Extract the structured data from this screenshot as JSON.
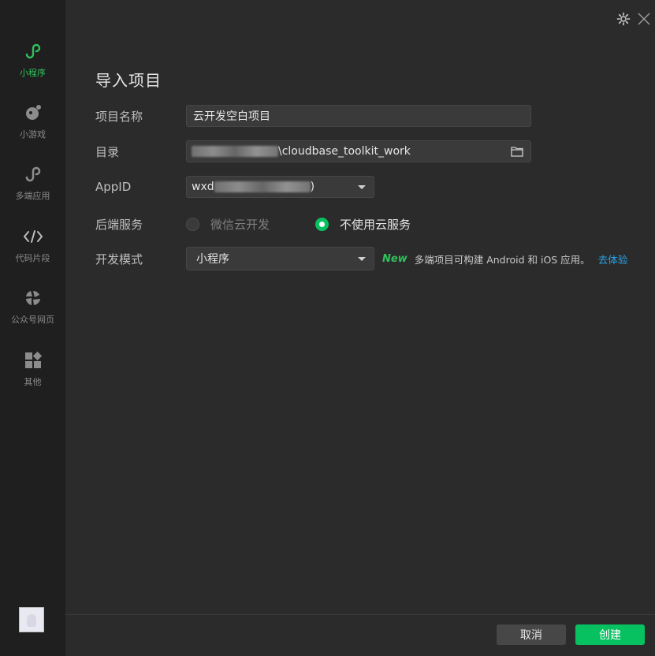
{
  "sidebar": {
    "items": [
      {
        "label": "小程序",
        "icon": "mini-program-icon"
      },
      {
        "label": "小游戏",
        "icon": "mini-game-icon"
      },
      {
        "label": "多端应用",
        "icon": "multi-app-icon"
      },
      {
        "label": "代码片段",
        "icon": "code-snippet-icon"
      },
      {
        "label": "公众号网页",
        "icon": "official-account-web-icon"
      },
      {
        "label": "其他",
        "icon": "other-apps-icon"
      }
    ],
    "active_color": "#2fc25b"
  },
  "dialog": {
    "title": "导入项目",
    "project_name": {
      "label": "项目名称",
      "value": "云开发空白项目"
    },
    "directory": {
      "label": "目录",
      "value": "\\cloudbase_toolkit_work"
    },
    "appid": {
      "label": "AppID",
      "value_prefix": "wxd",
      "value_suffix": ")"
    },
    "backend": {
      "label": "后端服务",
      "options": [
        "微信云开发",
        "不使用云服务"
      ],
      "selected": "不使用云服务"
    },
    "dev_mode": {
      "label": "开发模式",
      "value": "小程序",
      "new_tag": "New",
      "hint": "多端项目可构建 Android 和 iOS 应用。",
      "link": "去体验"
    }
  },
  "footer": {
    "cancel": "取消",
    "create": "创建"
  },
  "colors": {
    "accent": "#07c160",
    "link": "#2aa4e6",
    "background": "#2b2b2b",
    "sidebar": "#1f1f1f"
  }
}
